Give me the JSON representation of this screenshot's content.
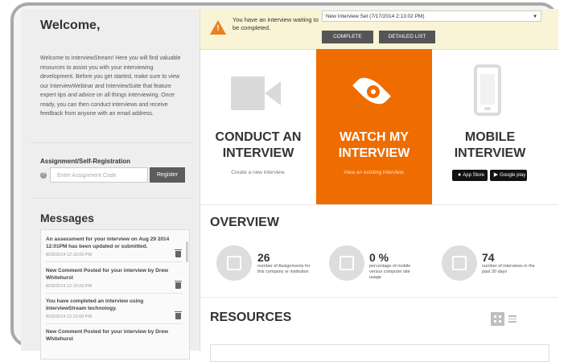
{
  "sidebar": {
    "welcome_title": "Welcome,",
    "welcome_text": "Welcome to InterviewStream! Here you will find valuable resources to assist you with your interviewing development. Before you get started, make sure to view our InterviewWebinar and InterviewSuite that feature expert tips and advice on all things interviewing. Once ready, you can then conduct interviews and receive feedback from anyone with an email address.",
    "assignment_title": "Assignment/Self-Registration",
    "assignment_placeholder": "Enter Assignment Code",
    "register_label": "Register",
    "messages_title": "Messages",
    "messages": [
      {
        "text": "An assessment for your interview on Aug 29 2014 12:01PM has been updated or submitted.",
        "date": "8/29/2014 12:16:00 PM"
      },
      {
        "text": "New Comment Posted for your interview by Drew Whitehurst",
        "date": "8/29/2014 12:15:00 PM"
      },
      {
        "text": "You have completed an interview using InterviewStream technology.",
        "date": "8/29/2014 12:12:00 PM"
      },
      {
        "text": "New Comment Posted for your interview by Drew Whitehurst",
        "date": ""
      }
    ]
  },
  "notification": {
    "text": "You have an interview waiting to be completed.",
    "selected_interview": "New Interview Set (7/17/2014 2:13:02 PM)",
    "complete_label": "COMPLETE",
    "detailed_list_label": "DETAILED LIST"
  },
  "cards": [
    {
      "title": "CONDUCT AN INTERVIEW",
      "subtitle": "Create a new interview.",
      "icon": "video-camera-icon"
    },
    {
      "title": "WATCH MY INTERVIEW",
      "subtitle": "View an existing interview.",
      "icon": "eye-icon"
    },
    {
      "title": "MOBILE INTERVIEW",
      "subtitle": "",
      "icon": "mobile-phone-icon",
      "badges": [
        "App Store",
        "Google play"
      ]
    }
  ],
  "overview": {
    "title": "OVERVIEW",
    "stats": [
      {
        "value": "26",
        "label": "number of Assignments for this company or institution",
        "icon": "edit-icon"
      },
      {
        "value": "0 %",
        "label": "percentage of mobile versus computer site usage",
        "icon": "laptop-icon"
      },
      {
        "value": "74",
        "label": "number of interviews in the past 30 days",
        "icon": "video-camera-icon"
      }
    ]
  },
  "resources": {
    "title": "RESOURCES"
  },
  "colors": {
    "accent": "#ef6c00",
    "notification_bg": "#f8f4d5",
    "sidebar_bg": "#eeeeee",
    "button_dark": "#555555"
  }
}
